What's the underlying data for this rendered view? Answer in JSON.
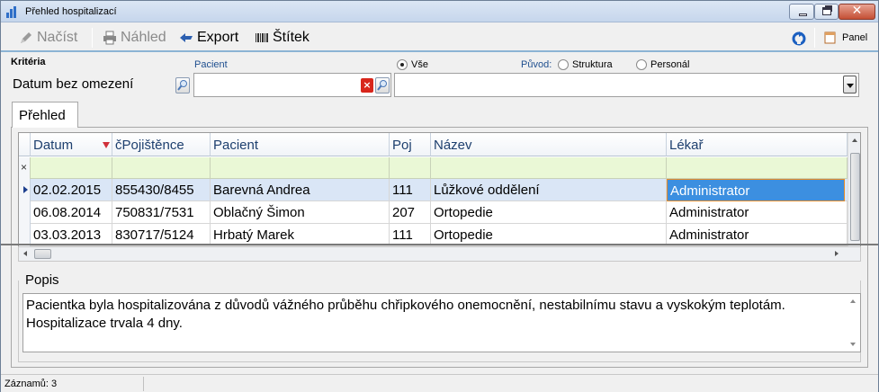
{
  "window": {
    "title": "Přehled hospitalizací",
    "icon": "bar-chart-icon",
    "controls": {
      "minimize": "minimize-icon",
      "maximize": "restore-icon",
      "close": "✕"
    }
  },
  "toolbar": {
    "load_label": "Načíst",
    "preview_label": "Náhled",
    "export_label": "Export",
    "label_label": "Štítek",
    "panel_label": "Panel",
    "refresh_icon": "refresh-icon"
  },
  "criteria": {
    "title": "Kritéria",
    "date_filter_value": "Datum bez omezení",
    "patient_label": "Pacient",
    "patient_value": "",
    "scope": {
      "all_label": "Vše",
      "origin_label": "Původ:",
      "structure_label": "Struktura",
      "personnel_label": "Personál",
      "selected": "Vše"
    },
    "origin_value": ""
  },
  "tabs": [
    {
      "label": "Přehled",
      "active": true
    }
  ],
  "grid": {
    "columns": [
      "Datum",
      "čPojištěnce",
      "Pacient",
      "Poj",
      "Název",
      "Lékař"
    ],
    "sort_column": "Datum",
    "sort_direction": "desc",
    "filter_clear_symbol": "×",
    "rows": [
      [
        "02.02.2015",
        "855430/8455",
        "Barevná Andrea",
        "111",
        "Lůžkové oddělení",
        "Administrator"
      ],
      [
        "06.08.2014",
        "750831/7531",
        "Oblačný  Šimon",
        "207",
        "Ortopedie",
        "Administrator"
      ],
      [
        "03.03.2013",
        "830717/5124",
        "Hrbatý Marek",
        "111",
        "Ortopedie",
        "Administrator"
      ]
    ],
    "selected_row": 0
  },
  "popis": {
    "label": "Popis",
    "text": "Pacientka byla hospitalizována z důvodů vážného průběhu chřipkového onemocnění, nestabilnímu stavu a vyskokým teplotám. Hospitalizace trvala 4 dny."
  },
  "status": {
    "records": "Záznamů: 3"
  },
  "colors": {
    "accent": "#3c8fe0",
    "selected_row": "#dae6f6",
    "filter_row": "#eaf8d6",
    "header_text": "#1d3f6e"
  }
}
